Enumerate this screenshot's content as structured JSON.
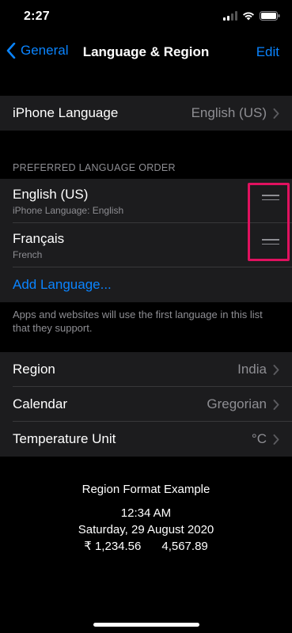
{
  "status_bar": {
    "time": "2:27"
  },
  "nav": {
    "back_label": "General",
    "title": "Language & Region",
    "edit_label": "Edit"
  },
  "iphone_language": {
    "label": "iPhone Language",
    "value": "English (US)"
  },
  "preferred_order": {
    "header": "PREFERRED LANGUAGE ORDER",
    "languages": [
      {
        "name": "English (US)",
        "subtitle": "iPhone Language: English"
      },
      {
        "name": "Français",
        "subtitle": "French"
      }
    ],
    "add_label": "Add Language...",
    "footer": "Apps and websites will use the first language in this list that they support."
  },
  "region_settings": [
    {
      "label": "Region",
      "value": "India"
    },
    {
      "label": "Calendar",
      "value": "Gregorian"
    },
    {
      "label": "Temperature Unit",
      "value": "°C"
    }
  ],
  "format_example": {
    "title": "Region Format Example",
    "time": "12:34 AM",
    "date": "Saturday, 29 August 2020",
    "currency": "₹ 1,234.56",
    "number": "4,567.89"
  },
  "colors": {
    "accent": "#0a84ff",
    "highlight_box": "#e0115f",
    "background": "#000000",
    "cell": "#1c1c1e"
  }
}
